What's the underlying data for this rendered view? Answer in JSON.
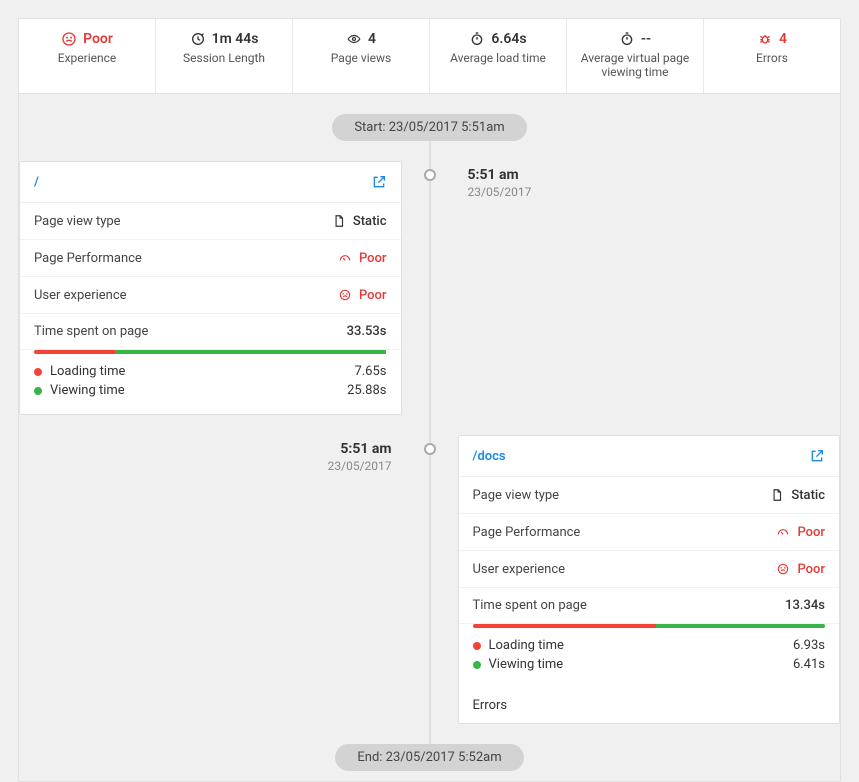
{
  "stats": {
    "experience": {
      "value": "Poor",
      "label": "Experience"
    },
    "session_length": {
      "value": "1m 44s",
      "label": "Session Length"
    },
    "page_views": {
      "value": "4",
      "label": "Page views"
    },
    "avg_load": {
      "value": "6.64s",
      "label": "Average load time"
    },
    "avg_view": {
      "value": "--",
      "label": "Average virtual page viewing time"
    },
    "errors": {
      "value": "4",
      "label": "Errors"
    }
  },
  "start_pill": "Start: 23/05/2017  5:51am",
  "end_pill": "End: 23/05/2017  5:52am",
  "entry1": {
    "time": "5:51 am",
    "date": "23/05/2017",
    "path": "/",
    "pv_type_label": "Page view type",
    "pv_type_value": "Static",
    "perf_label": "Page Performance",
    "perf_value": "Poor",
    "ux_label": "User experience",
    "ux_value": "Poor",
    "spent_label": "Time spent on page",
    "spent_value": "33.53s",
    "load_label": "Loading time",
    "load_value": "7.65s",
    "view_label": "Viewing time",
    "view_value": "25.88s",
    "load_pct": 23,
    "view_pct": 77
  },
  "entry2": {
    "time": "5:51 am",
    "date": "23/05/2017",
    "path": "/docs",
    "pv_type_label": "Page view type",
    "pv_type_value": "Static",
    "perf_label": "Page Performance",
    "perf_value": "Poor",
    "ux_label": "User experience",
    "ux_value": "Poor",
    "spent_label": "Time spent on page",
    "spent_value": "13.34s",
    "load_label": "Loading time",
    "load_value": "6.93s",
    "view_label": "Viewing time",
    "view_value": "6.41s",
    "err_label": "Errors",
    "load_pct": 52,
    "view_pct": 48
  }
}
